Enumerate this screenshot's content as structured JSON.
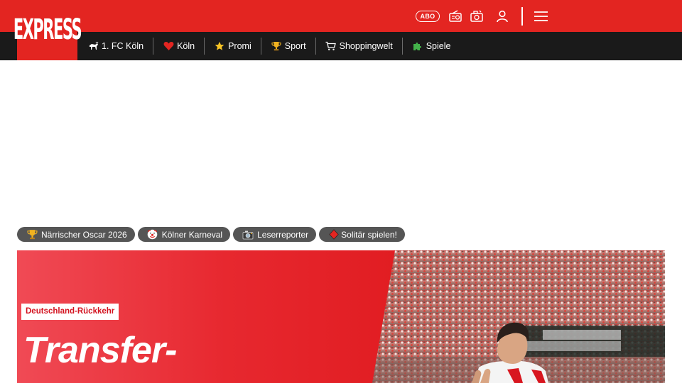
{
  "header": {
    "logo_text": "EXPRESS",
    "abo_label": "ABO",
    "icons": [
      "radio-icon",
      "camera-icon",
      "user-icon",
      "menu-icon"
    ],
    "brand_color": "#e32521"
  },
  "nav": {
    "items": [
      {
        "label": "1. FC Köln",
        "icon": "goat-icon"
      },
      {
        "label": "Köln",
        "icon": "heart-icon"
      },
      {
        "label": "Promi",
        "icon": "star-icon"
      },
      {
        "label": "Sport",
        "icon": "trophy-icon"
      },
      {
        "label": "Shoppingwelt",
        "icon": "cart-icon"
      },
      {
        "label": "Spiele",
        "icon": "puzzle-icon"
      }
    ]
  },
  "topics": [
    {
      "label": "Närrischer Oscar 2026",
      "icon": "trophy-icon"
    },
    {
      "label": "Kölner Karneval",
      "icon": "clown-icon"
    },
    {
      "label": "Leserreporter",
      "icon": "camera-icon"
    },
    {
      "label": "Solitär spielen!",
      "icon": "diamond-icon"
    }
  ],
  "hero": {
    "kicker": "Deutschland-Rückkehr",
    "headline": "Transfer-"
  }
}
